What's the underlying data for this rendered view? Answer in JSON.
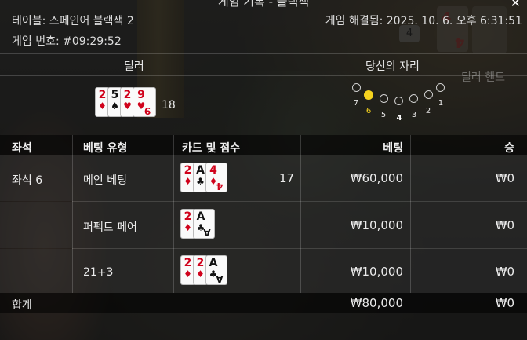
{
  "window": {
    "title": "게임 기록 - 블랙잭",
    "close_label": "✕"
  },
  "info": {
    "table": "테이블: 스페인어 블랙잭 2",
    "game_id": "게임 번호: #09:29:52",
    "resolved": "게임 해결됨: 2025. 10. 6. 오후 6:31:51"
  },
  "background": {
    "badge": "4",
    "ghost_label": "딜러 핸드",
    "ghost_card_rank": "4"
  },
  "dealer": {
    "label": "딜러",
    "score": "18",
    "cards": [
      {
        "rank": "2",
        "suit": "♦",
        "color": "red"
      },
      {
        "rank": "5",
        "suit": "♠",
        "color": "black"
      },
      {
        "rank": "2",
        "suit": "♥",
        "color": "red"
      },
      {
        "rank": "9",
        "suit": "♥",
        "color": "red"
      }
    ]
  },
  "seats": {
    "label": "당신의 자리",
    "numbers": [
      "7",
      "6",
      "5",
      "4",
      "3",
      "2",
      "1"
    ],
    "active": "6",
    "colors": {
      "active": "#f5d21e"
    }
  },
  "table": {
    "headers": {
      "seat": "좌석",
      "bet_type": "베팅 유형",
      "cards": "카드 및 점수",
      "bet": "베팅",
      "win": "승"
    },
    "seat_name": "좌석 6",
    "rows": [
      {
        "type": "메인 베팅",
        "score": "17",
        "bet": "₩60,000",
        "win": "₩0",
        "cards": [
          {
            "rank": "2",
            "suit": "♦",
            "color": "red"
          },
          {
            "rank": "A",
            "suit": "♣",
            "color": "black"
          },
          {
            "rank": "4",
            "suit": "♦",
            "color": "red"
          }
        ]
      },
      {
        "type": "퍼펙트 페어",
        "score": "",
        "bet": "₩10,000",
        "win": "₩0",
        "cards": [
          {
            "rank": "2",
            "suit": "♦",
            "color": "red"
          },
          {
            "rank": "A",
            "suit": "♣",
            "color": "black"
          }
        ]
      },
      {
        "type": "21+3",
        "score": "",
        "bet": "₩10,000",
        "win": "₩0",
        "cards": [
          {
            "rank": "2",
            "suit": "♦",
            "color": "red"
          },
          {
            "rank": "2",
            "suit": "♦",
            "color": "red"
          },
          {
            "rank": "A",
            "suit": "♣",
            "color": "black"
          }
        ]
      }
    ],
    "total": {
      "label": "합계",
      "bet": "₩80,000",
      "win": "₩0"
    }
  }
}
